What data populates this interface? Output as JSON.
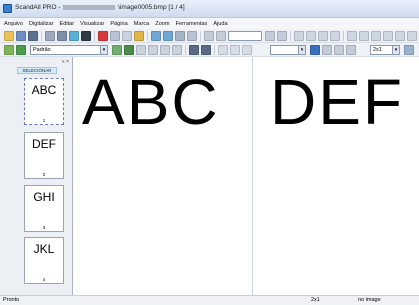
{
  "window": {
    "app_name": "ScandAll PRO",
    "file_name": "\\image0005.bmp",
    "page_indicator": "[1 / 4]"
  },
  "menu": [
    "Arquivo",
    "Digitalizar",
    "Editar",
    "Visualizar",
    "Página",
    "Marca",
    "Zoom",
    "Ferramentas",
    "Ajuda"
  ],
  "toolbar": {
    "profile_combo": "Padrão",
    "zoom_combo": "2x1"
  },
  "thumbnails": {
    "header": "SELECIONAR",
    "pane_controls": "« ×",
    "items": [
      {
        "text": "ABC",
        "number": "1"
      },
      {
        "text": "DEF",
        "number": "2"
      },
      {
        "text": "GHI",
        "number": "3"
      },
      {
        "text": "JKL",
        "number": "4"
      }
    ]
  },
  "viewer": {
    "left_page_text": "ABC",
    "right_page_text": "DEF"
  },
  "status": {
    "left": "Pronto",
    "zoom": "2x1",
    "right": "no image"
  },
  "colors": {
    "title_gradient_top": "#e8f0fa",
    "selection_border": "#6a78c8",
    "header_fill": "#d4ecf7"
  }
}
